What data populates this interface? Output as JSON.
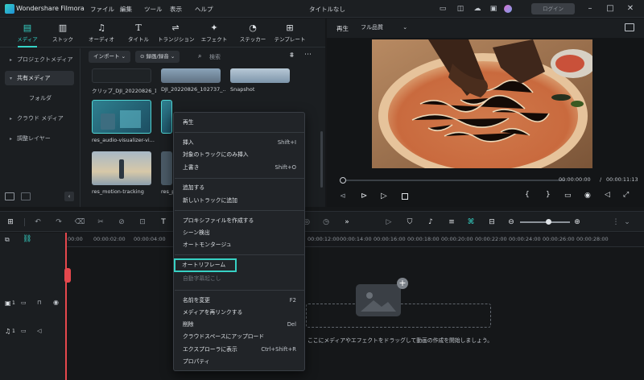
{
  "app": {
    "name": "Wondershare Filmora",
    "window_title": "タイトルなし",
    "menu": [
      "ファイル",
      "編集",
      "ツール",
      "表示",
      "ヘルプ"
    ],
    "login_label": "ログイン"
  },
  "media_toolbar": {
    "items": [
      {
        "label": "メディア",
        "icon": "media-icon",
        "active": true
      },
      {
        "label": "ストック",
        "icon": "stock-icon"
      },
      {
        "label": "オーディオ",
        "icon": "music-note-icon"
      },
      {
        "label": "タイトル",
        "icon": "title-text-icon"
      },
      {
        "label": "トランジション",
        "icon": "transition-icon"
      },
      {
        "label": "エフェクト",
        "icon": "effects-icon"
      },
      {
        "label": "ステッカー",
        "icon": "sticker-icon"
      },
      {
        "label": "テンプレート",
        "icon": "template-icon"
      }
    ]
  },
  "sidebar": {
    "items": [
      {
        "label": "プロジェクトメディア",
        "arrow": "▸"
      },
      {
        "label": "共有メディア",
        "arrow": "▾"
      },
      {
        "label": "フォルダ",
        "arrow": ""
      },
      {
        "label": "クラウド メディア",
        "arrow": "▸"
      },
      {
        "label": "調整レイヤー",
        "arrow": "▸"
      }
    ]
  },
  "browser": {
    "import_label": "インポート",
    "record_label": "録画/録音",
    "search_placeholder": "検索",
    "clips": [
      {
        "label": "クリップ_DJI_20220826_1..."
      },
      {
        "label": "DJI_20220826_102737_..."
      },
      {
        "label": "Snapshot"
      },
      {
        "label": "res_audio-visualizer-vi..."
      },
      {
        "label": "res_motion-tracking"
      },
      {
        "label": "res_p"
      }
    ]
  },
  "preview": {
    "tab_label": "再生",
    "quality_label": "フル品質",
    "current_time": "00:00:00:00",
    "separator": "/",
    "total_time": "00:00:11:13"
  },
  "timeline": {
    "ruler": [
      "00:00",
      "00:00:02:00",
      "00:00:04:00",
      "00:00:12:00",
      "00:00:14:00",
      "00:00:16:00",
      "00:00:18:00",
      "00:00:20:00",
      "00:00:22:00",
      "00:00:24:00",
      "00:00:26:00",
      "00:00:28:00"
    ],
    "video_track_num": "1",
    "audio_track_num": "1",
    "drop_hint": "ここにメディアやエフェクトをドラッグして動画の作成を開始しましょう。"
  },
  "context_menu": {
    "items": [
      {
        "label": "再生",
        "shortcut": ""
      },
      {
        "label": "挿入",
        "shortcut": "Shift+I"
      },
      {
        "label": "対象のトラックにのみ挿入",
        "shortcut": ""
      },
      {
        "label": "上書き",
        "shortcut": "Shift+O"
      },
      {
        "label": "追加する",
        "shortcut": ""
      },
      {
        "label": "新しいトラックに追加",
        "shortcut": ""
      },
      {
        "label": "プロキシファイルを作成する",
        "shortcut": ""
      },
      {
        "label": "シーン検出",
        "shortcut": ""
      },
      {
        "label": "オートモンタージュ",
        "shortcut": ""
      },
      {
        "label": "オートリフレーム",
        "shortcut": ""
      },
      {
        "label": "自動字幕起こし",
        "shortcut": ""
      },
      {
        "label": "名前を変更",
        "shortcut": "F2"
      },
      {
        "label": "メディアを再リンクする",
        "shortcut": ""
      },
      {
        "label": "削除",
        "shortcut": "Del"
      },
      {
        "label": "クラウドスペースにアップロード",
        "shortcut": ""
      },
      {
        "label": "エクスプローラに表示",
        "shortcut": "Ctrl+Shift+R"
      },
      {
        "label": "プロパティ",
        "shortcut": ""
      }
    ]
  },
  "colors": {
    "accent": "#35d3c6",
    "playhead": "#e5484d"
  }
}
